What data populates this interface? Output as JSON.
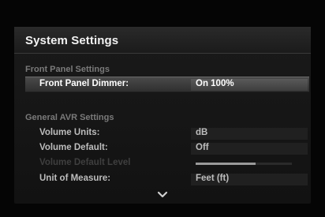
{
  "panel": {
    "title": "System Settings"
  },
  "sections": {
    "front_panel": {
      "heading": "Front Panel Settings",
      "rows": [
        {
          "label": "Front Panel Dimmer:",
          "value": "On 100%"
        }
      ]
    },
    "general_avr": {
      "heading": "General AVR Settings",
      "rows": [
        {
          "label": "Volume Units:",
          "value": "dB"
        },
        {
          "label": "Volume Default:",
          "value": "Off"
        },
        {
          "label": "Volume Default Level",
          "value": ""
        },
        {
          "label": "Unit of Measure:",
          "value": "Feet (ft)"
        }
      ]
    }
  },
  "volume_default_level": {
    "fill_fraction": 0.62
  },
  "icons": {
    "scroll_down": "chevron-down-icon"
  }
}
